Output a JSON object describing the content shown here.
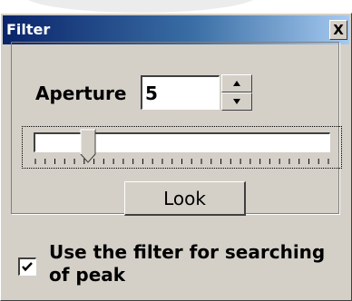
{
  "window": {
    "title": "Filter",
    "close_label": "X"
  },
  "aperture": {
    "label": "Aperture",
    "value": "5"
  },
  "slider": {
    "level_fraction": 0.18,
    "tick_count": 31
  },
  "look_button": {
    "label": "Look"
  },
  "peak_filter": {
    "label": "Use the filter for searching of peak",
    "checked": true
  },
  "colors": {
    "title_start": "#0a246a",
    "title_end": "#a6caf0",
    "face": "#d4d0c8"
  },
  "icons": [
    "close-icon",
    "arrow-up-icon",
    "arrow-down-icon",
    "checkmark-icon"
  ]
}
